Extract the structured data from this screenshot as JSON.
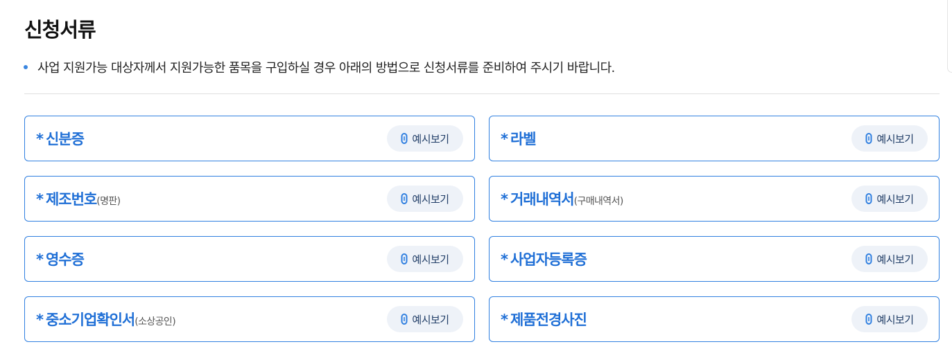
{
  "title": "신청서류",
  "notice": "사업 지원가능 대상자께서 지원가능한 품목을 구입하실 경우 아래의 방법으로 신청서류를 준비하여 주시기 바랍니다.",
  "star": "*",
  "documents": [
    {
      "name": "신분증",
      "sub": "",
      "button": "예시보기"
    },
    {
      "name": "라벨",
      "sub": "",
      "button": "예시보기"
    },
    {
      "name": "제조번호",
      "sub": "(명판)",
      "button": "예시보기"
    },
    {
      "name": "거래내역서",
      "sub": "(구매내역서)",
      "button": "예시보기"
    },
    {
      "name": "영수증",
      "sub": "",
      "button": "예시보기"
    },
    {
      "name": "사업자등록증",
      "sub": "",
      "button": "예시보기"
    },
    {
      "name": "중소기업확인서",
      "sub": "(소상공인)",
      "button": "예시보기"
    },
    {
      "name": "제품전경사진",
      "sub": "",
      "button": "예시보기"
    }
  ],
  "icons": {
    "button_icon": "paperclip-icon",
    "bullet": "bullet-dot"
  },
  "colors": {
    "accent": "#2f7fe0",
    "label": "#1f6fd6",
    "button_bg": "#eef2f8"
  }
}
